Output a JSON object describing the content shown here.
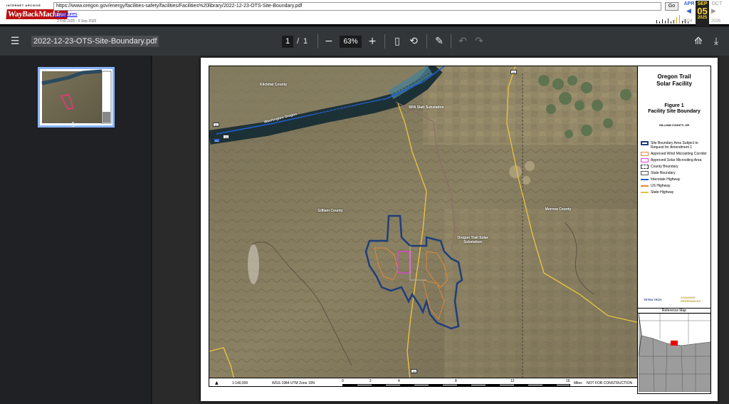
{
  "wayback": {
    "logo_top": "INTERNET ARCHIVE",
    "logo_main": "WayBackMachine",
    "url": "https://www.oregon.gov/energy/facilities-safety/facilities/Facilities%20library/2022-12-23-OTS-Site-Boundary.pdf",
    "go_label": "Go",
    "captures_link": "3 captures",
    "capture_range": "2 Feb 2025 - 5 Sep 2025",
    "prev_month": "APR",
    "cur_month": "SEP",
    "cur_day": "05",
    "cur_year": "2025",
    "next_month": "OCT",
    "prev_year": "2024",
    "next_year": "2026"
  },
  "viewer": {
    "doc_title": "2022-12-23-OTS-Site-Boundary.pdf",
    "page_current": "1",
    "page_sep": "/",
    "page_total": "1",
    "zoom": "63%",
    "thumb_label": "1"
  },
  "map": {
    "title": "Oregon Trail\nSolar Facility",
    "figure": "Figure 1\nFacility Site Boundary",
    "county": "GILLIAM COUNTY, OR",
    "labels": {
      "washington": "Washington\nOregon",
      "bpa": "BPA Slatt\nSubstation",
      "solar_sub": "Oregon Trail Solar\nSubstation",
      "gilliam_county": "Gilliam\nCounty",
      "morrow_county": "Morrow\nCounty",
      "klickitat": "Klickitat\nCounty"
    },
    "highways": [
      "14",
      "84",
      "74",
      "19",
      "19"
    ],
    "scale": "1:140,000",
    "projection": "WGS 1984 UTM Zone 10N",
    "scale_ticks": [
      "0",
      "2",
      "4",
      "8",
      "12",
      "16"
    ],
    "scale_unit": "Miles",
    "not_for_construction": "NOT FOR CONSTRUCTION",
    "legend": [
      {
        "label": "Site Boundary Area Subject to Request for Amendment 1",
        "color": "#1f3e7a",
        "style": "thick-outline"
      },
      {
        "label": "Approved Wind Micrositing Corridor",
        "color": "#e0873a",
        "style": "outline"
      },
      {
        "label": "Approved Solar Micrositing Area",
        "color": "#e040e0",
        "style": "outline"
      },
      {
        "label": "County Boundary",
        "color": "#333333",
        "style": "dashed-outline"
      },
      {
        "label": "State Boundary",
        "color": "#555555",
        "style": "outline"
      },
      {
        "label": "Interstate Highway",
        "color": "#1f5fd0",
        "style": "line"
      },
      {
        "label": "US Highway",
        "color": "#e08a3a",
        "style": "line"
      },
      {
        "label": "State Highway",
        "color": "#e8c040",
        "style": "line"
      }
    ],
    "logo_left": "TETRA TECH",
    "logo_right": "AVANGRID RENEWABLES",
    "reference_title": "Reference Map"
  }
}
